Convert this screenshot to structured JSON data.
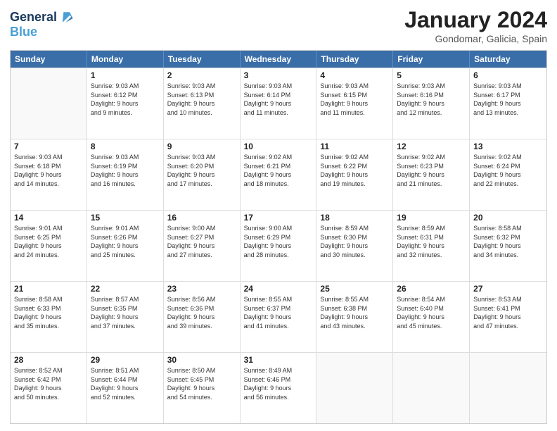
{
  "header": {
    "logo_line1": "General",
    "logo_line2": "Blue",
    "month_title": "January 2024",
    "location": "Gondomar, Galicia, Spain"
  },
  "days_of_week": [
    "Sunday",
    "Monday",
    "Tuesday",
    "Wednesday",
    "Thursday",
    "Friday",
    "Saturday"
  ],
  "weeks": [
    [
      {
        "day": "",
        "info": ""
      },
      {
        "day": "1",
        "info": "Sunrise: 9:03 AM\nSunset: 6:12 PM\nDaylight: 9 hours\nand 9 minutes."
      },
      {
        "day": "2",
        "info": "Sunrise: 9:03 AM\nSunset: 6:13 PM\nDaylight: 9 hours\nand 10 minutes."
      },
      {
        "day": "3",
        "info": "Sunrise: 9:03 AM\nSunset: 6:14 PM\nDaylight: 9 hours\nand 11 minutes."
      },
      {
        "day": "4",
        "info": "Sunrise: 9:03 AM\nSunset: 6:15 PM\nDaylight: 9 hours\nand 11 minutes."
      },
      {
        "day": "5",
        "info": "Sunrise: 9:03 AM\nSunset: 6:16 PM\nDaylight: 9 hours\nand 12 minutes."
      },
      {
        "day": "6",
        "info": "Sunrise: 9:03 AM\nSunset: 6:17 PM\nDaylight: 9 hours\nand 13 minutes."
      }
    ],
    [
      {
        "day": "7",
        "info": "Sunrise: 9:03 AM\nSunset: 6:18 PM\nDaylight: 9 hours\nand 14 minutes."
      },
      {
        "day": "8",
        "info": "Sunrise: 9:03 AM\nSunset: 6:19 PM\nDaylight: 9 hours\nand 16 minutes."
      },
      {
        "day": "9",
        "info": "Sunrise: 9:03 AM\nSunset: 6:20 PM\nDaylight: 9 hours\nand 17 minutes."
      },
      {
        "day": "10",
        "info": "Sunrise: 9:02 AM\nSunset: 6:21 PM\nDaylight: 9 hours\nand 18 minutes."
      },
      {
        "day": "11",
        "info": "Sunrise: 9:02 AM\nSunset: 6:22 PM\nDaylight: 9 hours\nand 19 minutes."
      },
      {
        "day": "12",
        "info": "Sunrise: 9:02 AM\nSunset: 6:23 PM\nDaylight: 9 hours\nand 21 minutes."
      },
      {
        "day": "13",
        "info": "Sunrise: 9:02 AM\nSunset: 6:24 PM\nDaylight: 9 hours\nand 22 minutes."
      }
    ],
    [
      {
        "day": "14",
        "info": "Sunrise: 9:01 AM\nSunset: 6:25 PM\nDaylight: 9 hours\nand 24 minutes."
      },
      {
        "day": "15",
        "info": "Sunrise: 9:01 AM\nSunset: 6:26 PM\nDaylight: 9 hours\nand 25 minutes."
      },
      {
        "day": "16",
        "info": "Sunrise: 9:00 AM\nSunset: 6:27 PM\nDaylight: 9 hours\nand 27 minutes."
      },
      {
        "day": "17",
        "info": "Sunrise: 9:00 AM\nSunset: 6:29 PM\nDaylight: 9 hours\nand 28 minutes."
      },
      {
        "day": "18",
        "info": "Sunrise: 8:59 AM\nSunset: 6:30 PM\nDaylight: 9 hours\nand 30 minutes."
      },
      {
        "day": "19",
        "info": "Sunrise: 8:59 AM\nSunset: 6:31 PM\nDaylight: 9 hours\nand 32 minutes."
      },
      {
        "day": "20",
        "info": "Sunrise: 8:58 AM\nSunset: 6:32 PM\nDaylight: 9 hours\nand 34 minutes."
      }
    ],
    [
      {
        "day": "21",
        "info": "Sunrise: 8:58 AM\nSunset: 6:33 PM\nDaylight: 9 hours\nand 35 minutes."
      },
      {
        "day": "22",
        "info": "Sunrise: 8:57 AM\nSunset: 6:35 PM\nDaylight: 9 hours\nand 37 minutes."
      },
      {
        "day": "23",
        "info": "Sunrise: 8:56 AM\nSunset: 6:36 PM\nDaylight: 9 hours\nand 39 minutes."
      },
      {
        "day": "24",
        "info": "Sunrise: 8:55 AM\nSunset: 6:37 PM\nDaylight: 9 hours\nand 41 minutes."
      },
      {
        "day": "25",
        "info": "Sunrise: 8:55 AM\nSunset: 6:38 PM\nDaylight: 9 hours\nand 43 minutes."
      },
      {
        "day": "26",
        "info": "Sunrise: 8:54 AM\nSunset: 6:40 PM\nDaylight: 9 hours\nand 45 minutes."
      },
      {
        "day": "27",
        "info": "Sunrise: 8:53 AM\nSunset: 6:41 PM\nDaylight: 9 hours\nand 47 minutes."
      }
    ],
    [
      {
        "day": "28",
        "info": "Sunrise: 8:52 AM\nSunset: 6:42 PM\nDaylight: 9 hours\nand 50 minutes."
      },
      {
        "day": "29",
        "info": "Sunrise: 8:51 AM\nSunset: 6:44 PM\nDaylight: 9 hours\nand 52 minutes."
      },
      {
        "day": "30",
        "info": "Sunrise: 8:50 AM\nSunset: 6:45 PM\nDaylight: 9 hours\nand 54 minutes."
      },
      {
        "day": "31",
        "info": "Sunrise: 8:49 AM\nSunset: 6:46 PM\nDaylight: 9 hours\nand 56 minutes."
      },
      {
        "day": "",
        "info": ""
      },
      {
        "day": "",
        "info": ""
      },
      {
        "day": "",
        "info": ""
      }
    ]
  ]
}
